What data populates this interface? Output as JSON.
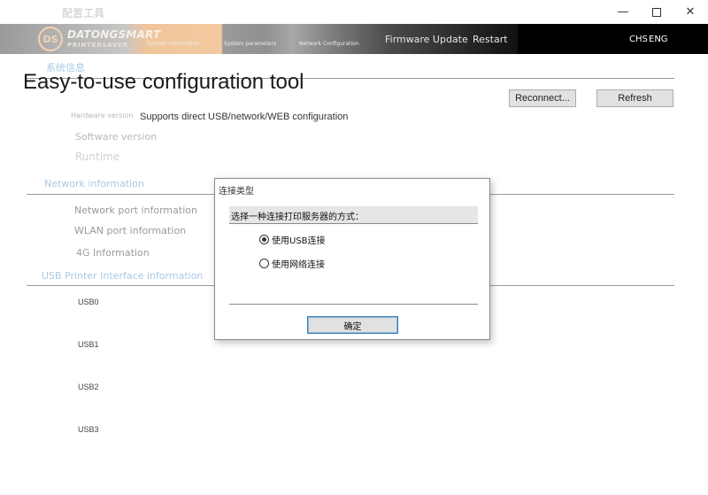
{
  "window": {
    "title": "配置工具",
    "controls": {
      "minimize_icon": "—",
      "close_icon": "✕"
    }
  },
  "banner": {
    "logo_mark": "DS",
    "logo_name": "DATONGSMART",
    "logo_sub": "PRINTERSAVER",
    "nav_small": [
      "System information",
      "System parameters",
      "Network Configuration"
    ],
    "nav_firmware": "Firmware Update",
    "nav_restart": "Restart",
    "lang_chs": "CHS",
    "lang_eng": "ENG"
  },
  "overlay": {
    "headline": "Easy-to-use configuration tool",
    "subline": "Supports direct USB/network/WEB configuration"
  },
  "toolbar": {
    "reconnect_label": "Reconnect...",
    "refresh_label": "Refresh"
  },
  "info": {
    "section_title": "系统信息",
    "hardware_version": "Hardware version",
    "software_version": "Software version",
    "runtime": "Runtime",
    "network_section": "Network information",
    "network_port": "Network port information",
    "wlan_port": "WLAN port information",
    "fourg": "4G Information",
    "usb_section": "USB Printer Interface information",
    "usb_ports": [
      "USB0",
      "USB1",
      "USB2",
      "USB3"
    ]
  },
  "dialog": {
    "title": "连接类型",
    "prompt": "选择一种连接打印服务器的方式：",
    "options": [
      {
        "label": "使用USB连接",
        "selected": true
      },
      {
        "label": "使用网络连接",
        "selected": false
      }
    ],
    "ok_label": "确定"
  },
  "colors": {
    "banner_dark": "#000000",
    "faded_text": "#b8b8b8",
    "faded_blue": "#a9c8e6",
    "focus_border": "#3c7fb1"
  }
}
